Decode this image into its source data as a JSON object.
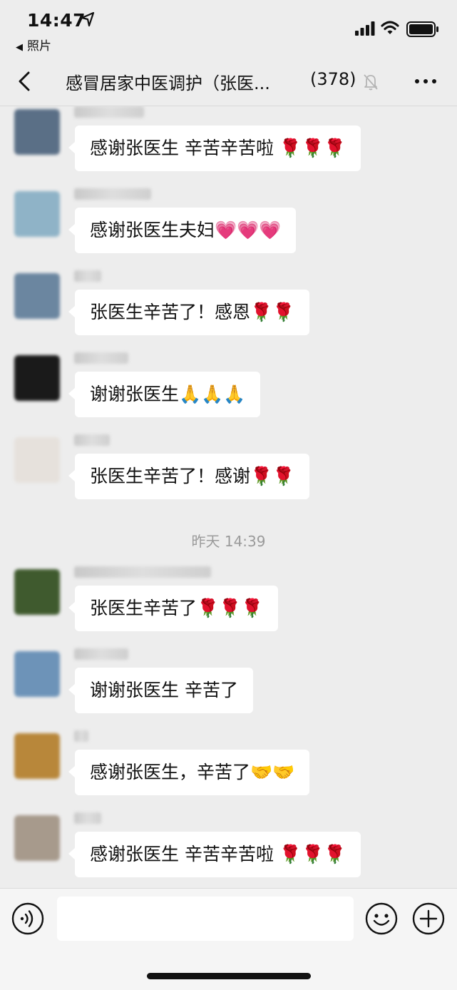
{
  "status_bar": {
    "time": "14:47",
    "back_app_arrow": "◀",
    "back_app_label": "照片"
  },
  "header": {
    "title": "感冒居家中医调护（张医...",
    "member_count": "(378)"
  },
  "messages": [
    {
      "text": "感谢张医生 辛苦辛苦啦 🌹🌹🌹",
      "avatar_color": "#5a6f86"
    },
    {
      "text": "感谢张医生夫妇💗💗💗",
      "avatar_color": "#8fb3c7"
    },
    {
      "text": "张医生辛苦了！感恩🌹🌹",
      "avatar_color": "#6b86a0"
    },
    {
      "text": "谢谢张医生🙏🙏🙏",
      "avatar_color": "#1a1a1a"
    },
    {
      "text": "张医生辛苦了！感谢🌹🌹",
      "avatar_color": "#e6e1dc"
    },
    {
      "text": "张医生辛苦了🌹🌹🌹",
      "avatar_color": "#3f5a2e"
    },
    {
      "text": "谢谢张医生 辛苦了",
      "avatar_color": "#6d93b8"
    },
    {
      "text": "感谢张医生，辛苦了🤝🤝",
      "avatar_color": "#b8873a"
    },
    {
      "text": "感谢张医生 辛苦辛苦啦 🌹🌹🌹",
      "avatar_color": "#a79a8c"
    }
  ],
  "timestamp": "昨天 14:39",
  "input": {
    "placeholder": ""
  },
  "colors": {
    "background": "#ededed",
    "bubble": "#ffffff",
    "timestamp_text": "#9a9a9a",
    "input_bar": "#f5f5f5"
  }
}
